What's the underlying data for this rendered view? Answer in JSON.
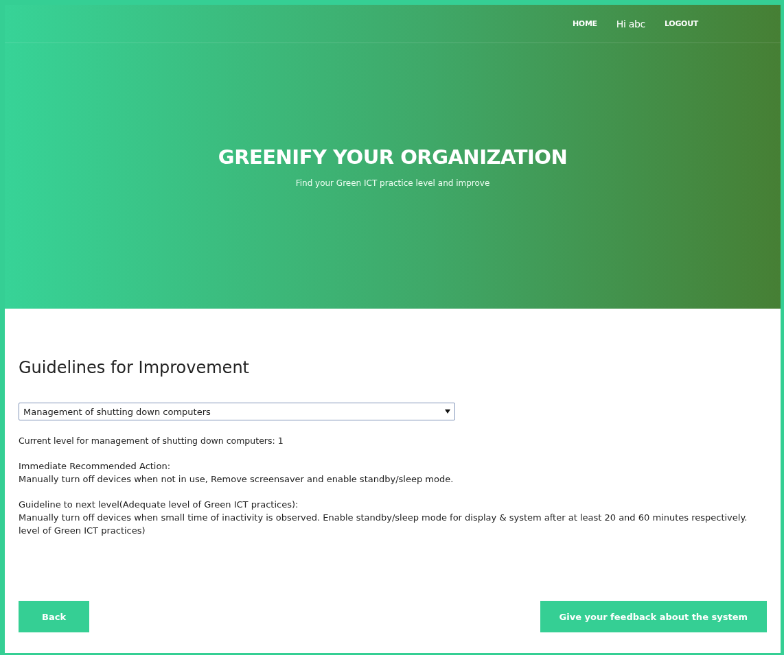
{
  "nav": {
    "items": [
      {
        "label": "HOME",
        "kind": "link"
      },
      {
        "label": "Hi abc",
        "kind": "greeting"
      },
      {
        "label": "LOGOUT",
        "kind": "link"
      }
    ]
  },
  "hero": {
    "title": "GREENIFY YOUR ORGANIZATION",
    "subtitle": "Find your Green ICT practice level and improve"
  },
  "content": {
    "heading": "Guidelines for Improvement",
    "select": {
      "value": "Management of shutting down computers"
    },
    "current_level": "Current level for management of shutting down computers: 1",
    "sections": [
      {
        "title": "Immediate Recommended Action:",
        "text": "Manually turn off devices when not in use, Remove screensaver and enable standby/sleep mode."
      },
      {
        "title": "Guideline to next level(Adequate level of Green ICT practices):",
        "text": "Manually turn off devices when small time of inactivity is observed. Enable standby/sleep mode for display & system after at least 20 and 60 minutes respectively.  level of Green ICT practices)"
      }
    ]
  },
  "buttons": [
    {
      "label": "Back"
    },
    {
      "label": "Give your feedback about the system"
    }
  ]
}
